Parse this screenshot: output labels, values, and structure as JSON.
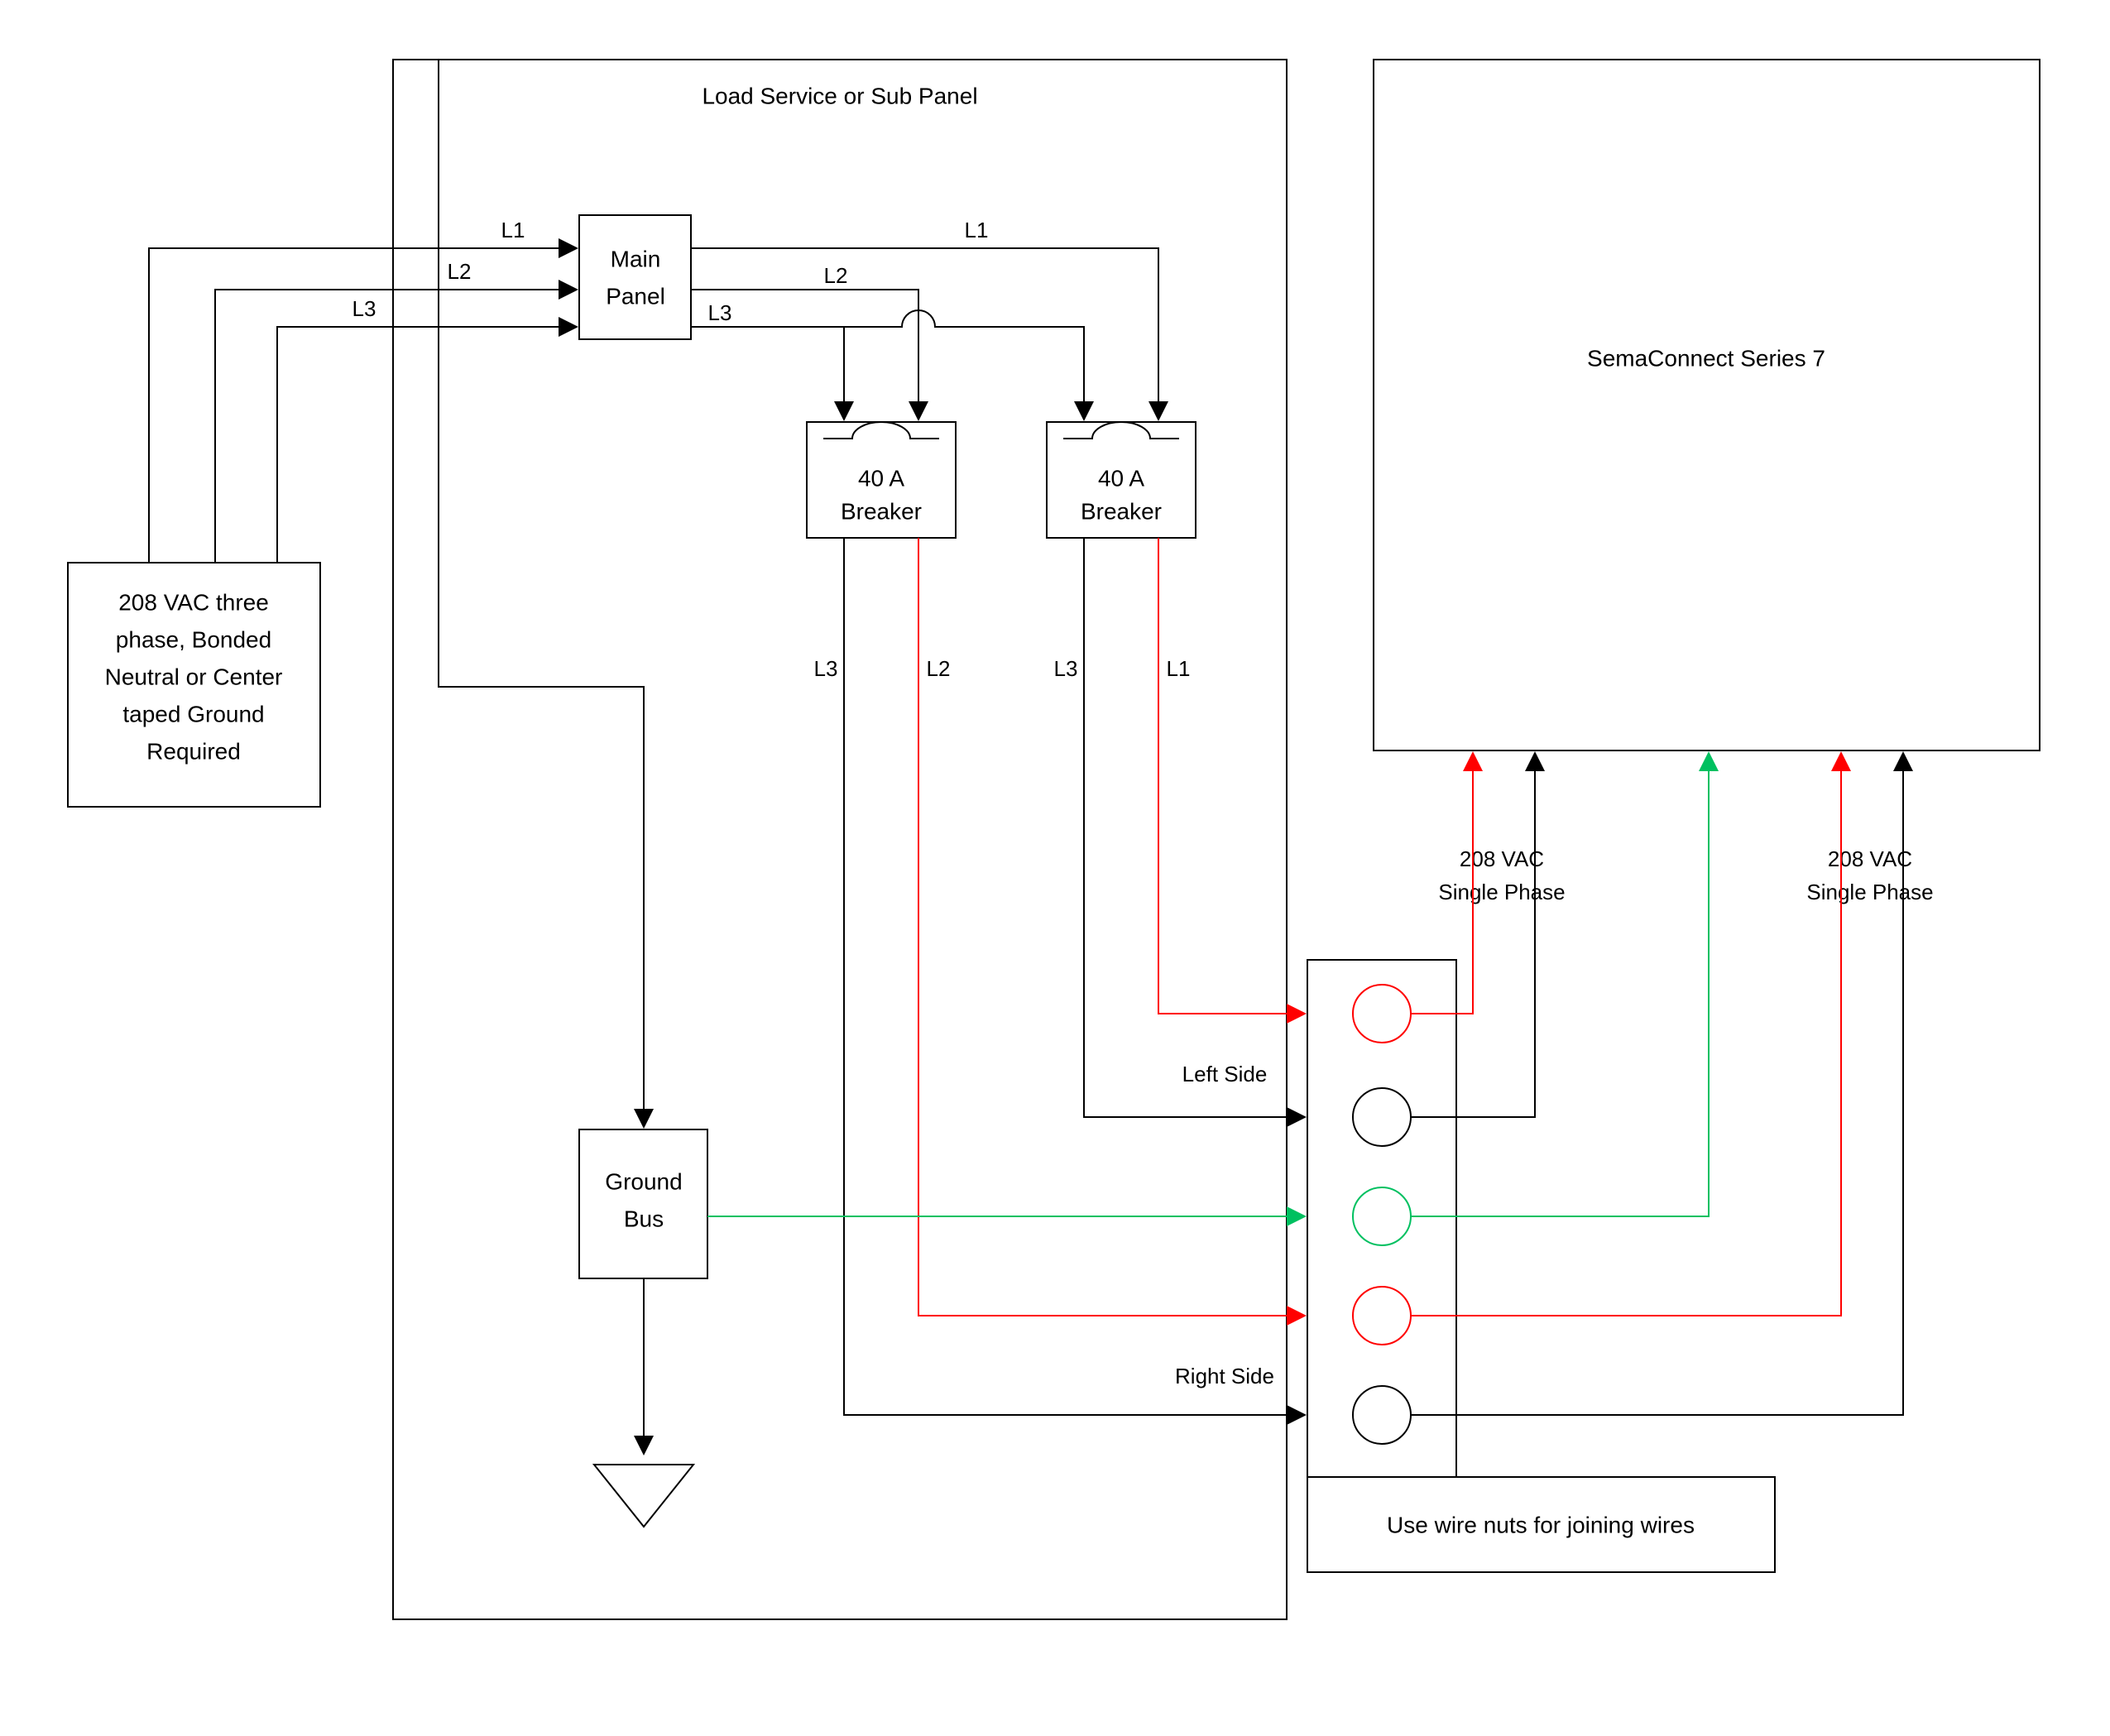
{
  "panel_title": "Load Service or Sub Panel",
  "source_box": {
    "l1": "208 VAC three",
    "l2": "phase, Bonded",
    "l3": "Neutral or Center",
    "l4": "taped Ground",
    "l5": "Required"
  },
  "main_panel": {
    "l1": "Main",
    "l2": "Panel"
  },
  "breaker": {
    "l1": "40 A",
    "l2": "Breaker"
  },
  "ground_bus": {
    "l1": "Ground",
    "l2": "Bus"
  },
  "device": "SemaConnect Series 7",
  "phase_labels": {
    "l1": "L1",
    "l2": "L2",
    "l3": "L3"
  },
  "side_labels": {
    "left": "Left Side",
    "right": "Right Side"
  },
  "phase_note": {
    "l1": "208 VAC",
    "l2": "Single Phase"
  },
  "wire_nuts": "Use wire nuts for joining wires"
}
